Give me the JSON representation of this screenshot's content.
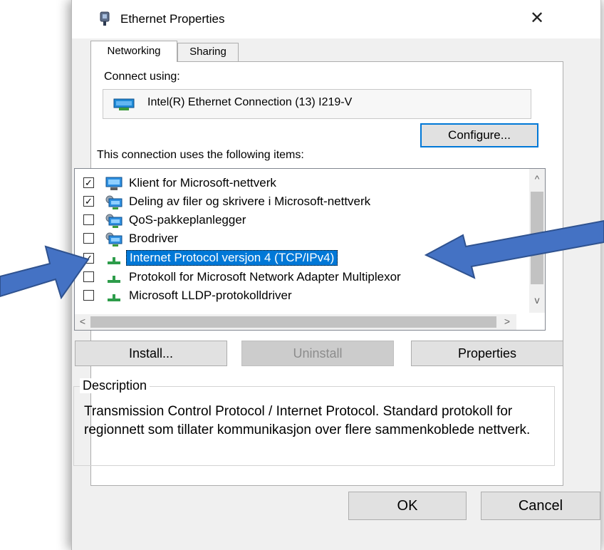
{
  "window": {
    "title": "Ethernet Properties",
    "close_glyph": "✕"
  },
  "tabs": [
    {
      "label": "Networking",
      "active": true
    },
    {
      "label": "Sharing",
      "active": false
    }
  ],
  "connect_using": {
    "label": "Connect using:",
    "adapter": "Intel(R) Ethernet Connection (13) I219-V",
    "configure_label": "Configure..."
  },
  "items": {
    "label": "This connection uses the following items:",
    "list": [
      {
        "label": "Klient for Microsoft-nettverk",
        "checked": true,
        "icon": "network-client-icon"
      },
      {
        "label": "Deling av filer og skrivere i Microsoft-nettverk",
        "checked": true,
        "icon": "network-service-icon"
      },
      {
        "label": "QoS-pakkeplanlegger",
        "checked": false,
        "icon": "network-service-icon"
      },
      {
        "label": "Brodriver",
        "checked": false,
        "icon": "network-service-icon"
      },
      {
        "label": "Internet Protocol versjon 4 (TCP/IPv4)",
        "checked": true,
        "icon": "protocol-icon",
        "selected": true
      },
      {
        "label": "Protokoll for Microsoft Network Adapter Multiplexor",
        "checked": false,
        "icon": "protocol-icon"
      },
      {
        "label": "Microsoft LLDP-protokolldriver",
        "checked": false,
        "icon": "protocol-icon"
      }
    ]
  },
  "buttons": {
    "install": "Install...",
    "uninstall": "Uninstall",
    "properties": "Properties",
    "ok": "OK",
    "cancel": "Cancel"
  },
  "description": {
    "legend": "Description",
    "text": "Transmission Control Protocol / Internet Protocol. Standard protokoll for regionnett som tillater kommunikasjon over flere sammenkoblede nettverk."
  },
  "scroll": {
    "up": "^",
    "down": "v",
    "left": "<",
    "right": ">"
  },
  "colors": {
    "selection": "#0078d7",
    "arrow_fill": "#4472c4",
    "arrow_stroke": "#2f528f"
  }
}
